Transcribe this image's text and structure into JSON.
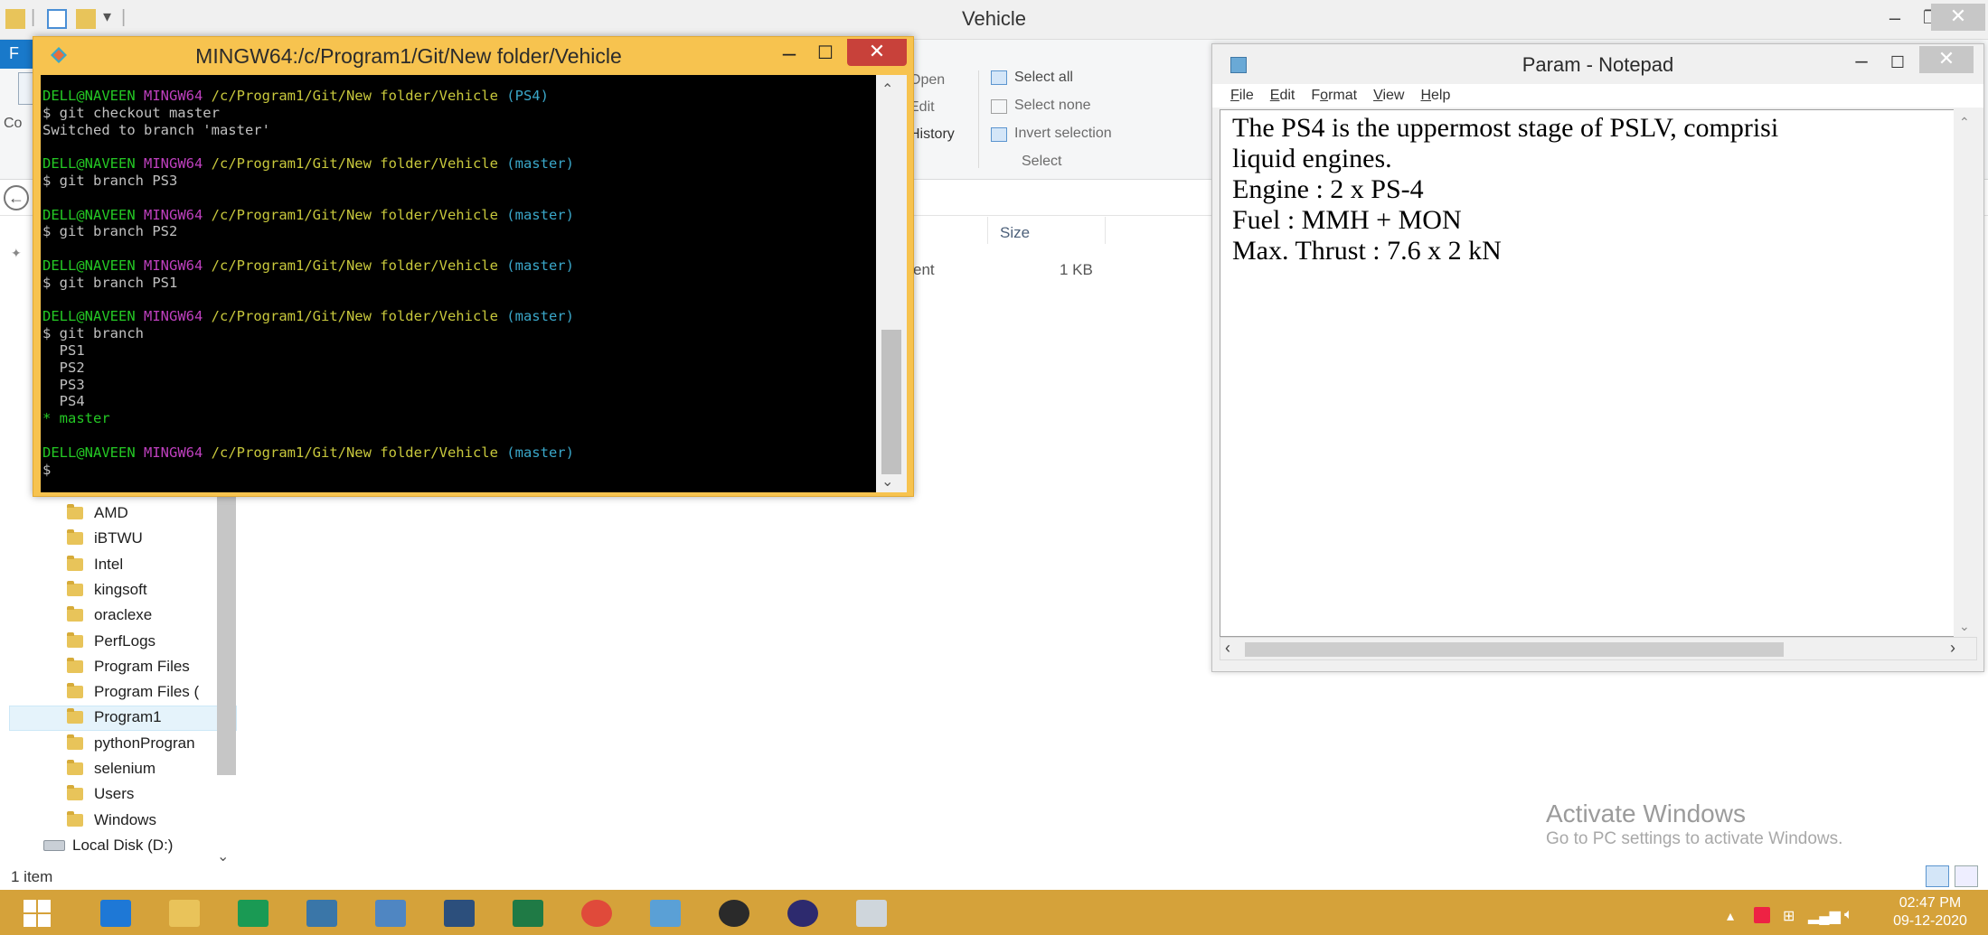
{
  "explorer": {
    "title": "Vehicle",
    "file_tab": "F",
    "ribbon": {
      "open": "Open",
      "edit": "Edit",
      "history": "History",
      "select_all": "Select all",
      "select_none": "Select none",
      "invert_selection": "Invert selection",
      "select_group": "Select",
      "left_cut_1": "Co"
    },
    "column_size": "Size",
    "file_row": {
      "type": "ent",
      "size": "1 KB"
    },
    "nav_items": [
      "AMD",
      "iBTWU",
      "Intel",
      "kingsoft",
      "oraclexe",
      "PerfLogs",
      "Program Files",
      "Program Files (",
      "Program1",
      "pythonProgran",
      "selenium",
      "Users",
      "Windows"
    ],
    "local_disk": "Local Disk (D:)",
    "status": "1 item",
    "activate_title": "Activate Windows",
    "activate_sub": "Go to PC settings to activate Windows."
  },
  "bash": {
    "title": "MINGW64:/c/Program1/Git/New folder/Vehicle",
    "prompt_user": "DELL@NAVEEN",
    "prompt_ming": "MINGW64",
    "prompt_path": "/c/Program1/Git/New folder/Vehicle",
    "lines": [
      {
        "kind": "prompt",
        "branch": "(PS4)"
      },
      {
        "kind": "cmd",
        "text": "$ git checkout master"
      },
      {
        "kind": "out",
        "text": "Switched to branch 'master'"
      },
      {
        "kind": "blank"
      },
      {
        "kind": "prompt",
        "branch": "(master)"
      },
      {
        "kind": "cmd",
        "text": "$ git branch PS3"
      },
      {
        "kind": "blank"
      },
      {
        "kind": "prompt",
        "branch": "(master)"
      },
      {
        "kind": "cmd",
        "text": "$ git branch PS2"
      },
      {
        "kind": "blank"
      },
      {
        "kind": "prompt",
        "branch": "(master)"
      },
      {
        "kind": "cmd",
        "text": "$ git branch PS1"
      },
      {
        "kind": "blank"
      },
      {
        "kind": "prompt",
        "branch": "(master)"
      },
      {
        "kind": "cmd",
        "text": "$ git branch"
      },
      {
        "kind": "out",
        "text": "  PS1"
      },
      {
        "kind": "out",
        "text": "  PS2"
      },
      {
        "kind": "out",
        "text": "  PS3"
      },
      {
        "kind": "out",
        "text": "  PS4"
      },
      {
        "kind": "current",
        "text": "* master"
      },
      {
        "kind": "blank"
      },
      {
        "kind": "prompt",
        "branch": "(master)"
      },
      {
        "kind": "cmd",
        "text": "$"
      }
    ]
  },
  "notepad": {
    "title": "Param - Notepad",
    "menu": [
      "File",
      "Edit",
      "Format",
      "View",
      "Help"
    ],
    "menu_underline": [
      "F",
      "E",
      "o",
      "V",
      "H"
    ],
    "lines": [
      "The PS4 is the uppermost stage of PSLV, comprisi",
      "liquid engines.",
      "Engine : 2 x PS-4",
      "Fuel : MMH + MON",
      "Max. Thrust : 7.6 x 2 kN"
    ]
  },
  "taskbar": {
    "apps": [
      {
        "icon": "internet-explorer-icon",
        "color": "#1e78d6"
      },
      {
        "icon": "file-explorer-icon",
        "color": "#e9c35a"
      },
      {
        "icon": "store-icon",
        "color": "#1a9a54"
      },
      {
        "icon": "python-icon",
        "color": "#3a76a8"
      },
      {
        "icon": "python-file-icon",
        "color": "#4f86c2"
      },
      {
        "icon": "sql-plus-icon",
        "color": "#2c4f7c"
      },
      {
        "icon": "excel-icon",
        "color": "#1f7a45"
      },
      {
        "icon": "chrome-icon",
        "color": "#e04a3a"
      },
      {
        "icon": "notepad-icon",
        "color": "#5aa0d6"
      },
      {
        "icon": "settings-app-icon",
        "color": "#2a2a2a"
      },
      {
        "icon": "eclipse-icon",
        "color": "#2d2a6e"
      },
      {
        "icon": "git-bash-icon",
        "color": "#cfd6dc"
      }
    ],
    "time": "02:47 PM",
    "date": "09-12-2020"
  },
  "colors": {
    "taskbar": "#d5a23a",
    "bash_frame": "#f7c34f",
    "bash_close": "#c8413a",
    "prompt_user": "#24c824",
    "prompt_ming": "#bf40bf",
    "prompt_path": "#c8c83c",
    "prompt_branch": "#3aa7c9"
  }
}
